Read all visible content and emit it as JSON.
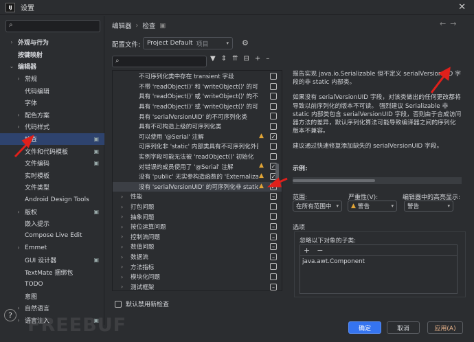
{
  "window": {
    "app_icon": "IJ",
    "title": "设置",
    "close": "✕"
  },
  "sidebar": {
    "items": [
      {
        "label": "外观与行为",
        "chev": "›",
        "bold": true
      },
      {
        "label": "按键映射",
        "chev": "",
        "bold": true
      },
      {
        "label": "编辑器",
        "chev": "⌄",
        "bold": true
      },
      {
        "label": "常规",
        "chev": "›",
        "indent": 1
      },
      {
        "label": "代码编辑",
        "chev": "",
        "indent": 1
      },
      {
        "label": "字体",
        "chev": "",
        "indent": 1
      },
      {
        "label": "配色方案",
        "chev": "›",
        "indent": 1
      },
      {
        "label": "代码样式",
        "chev": "›",
        "indent": 1
      },
      {
        "label": "检查",
        "chev": "",
        "indent": 1,
        "selected": true,
        "badge": "▣"
      },
      {
        "label": "文件和代码模板",
        "chev": "",
        "indent": 1,
        "badge": "▣"
      },
      {
        "label": "文件编码",
        "chev": "",
        "indent": 1,
        "badge": "▣"
      },
      {
        "label": "实时模板",
        "chev": "",
        "indent": 1
      },
      {
        "label": "文件类型",
        "chev": "",
        "indent": 1
      },
      {
        "label": "Android Design Tools",
        "chev": "",
        "indent": 1
      },
      {
        "label": "版权",
        "chev": "›",
        "indent": 1,
        "badge": "▣"
      },
      {
        "label": "嵌入提示",
        "chev": "",
        "indent": 1
      },
      {
        "label": "Compose Live Edit",
        "chev": "",
        "indent": 1
      },
      {
        "label": "Emmet",
        "chev": "›",
        "indent": 1
      },
      {
        "label": "GUI 设计器",
        "chev": "",
        "indent": 1,
        "badge": "▣"
      },
      {
        "label": "TextMate 捆绑包",
        "chev": "",
        "indent": 1
      },
      {
        "label": "TODO",
        "chev": "",
        "indent": 1
      },
      {
        "label": "意图",
        "chev": "",
        "indent": 1
      },
      {
        "label": "自然语言",
        "chev": "›",
        "indent": 1
      },
      {
        "label": "语言注入",
        "chev": "›",
        "indent": 1,
        "badge": "▣"
      }
    ]
  },
  "header": {
    "crumb1": "编辑器",
    "crumb_sep": "›",
    "crumb2": "检查",
    "crumb_badge": "▣",
    "back": "←",
    "forward": "→"
  },
  "profile": {
    "label": "配置文件:",
    "value": "Project Default",
    "hint": "项目",
    "dd": "▾"
  },
  "tree": {
    "search_icon": "⌕",
    "rows": [
      {
        "label": "不可序列化类中存在 transient 字段",
        "cb": "",
        "warn": false
      },
      {
        "label": "不带 'readObject()' 和 'writeObject()' 的可序",
        "cb": "",
        "warn": false
      },
      {
        "label": "具有 'readObject()' 或 'writeObject()' 的不可",
        "cb": "",
        "warn": false
      },
      {
        "label": "具有 'readObject()' 或 'writeObject()' 的可外",
        "cb": "",
        "warn": false
      },
      {
        "label": "具有 'serialVersionUID' 的不可序列化类",
        "cb": "",
        "warn": false
      },
      {
        "label": "具有不可构造上级的可序列化类",
        "cb": "",
        "warn": false
      },
      {
        "label": "可以使用 '@Serial' 注解",
        "cb": "✓",
        "warn": true
      },
      {
        "label": "可序列化非 'static' 内部类具有不可序列化外部",
        "cb": "",
        "warn": false
      },
      {
        "label": "实例字段可能无法被 'readObject()' 初始化",
        "cb": "",
        "warn": false
      },
      {
        "label": "对错误的成员使用了 '@Serial' 注解",
        "cb": "✓",
        "warn": true
      },
      {
        "label": "没有 'public' 无实参构造函数的 'Externalizab",
        "cb": "✓",
        "warn": true
      },
      {
        "label": "没有 'serialVersionUID' 的可序列化非 static",
        "cb": "✓",
        "warn": true,
        "selected": true
      },
      {
        "label": "性能",
        "cb": "minus",
        "group": true
      },
      {
        "label": "打包问题",
        "cb": "",
        "group": true
      },
      {
        "label": "抽象问题",
        "cb": "",
        "group": true
      },
      {
        "label": "按位运算问题",
        "cb": "minus",
        "group": true
      },
      {
        "label": "控制流问题",
        "cb": "minus",
        "group": true
      },
      {
        "label": "数值问题",
        "cb": "minus",
        "group": true
      },
      {
        "label": "数据流",
        "cb": "minus",
        "group": true
      },
      {
        "label": "方法指标",
        "cb": "",
        "group": true
      },
      {
        "label": "模块化问题",
        "cb": "",
        "group": true
      },
      {
        "label": "测试框架",
        "cb": "minus",
        "group": true
      }
    ]
  },
  "disable_new": "默认禁用新检查",
  "description": {
    "p1": "报告实现 java.io.Serializable 但不定义 serialVersionUID 字段的非 static 内部类。",
    "p2": "如果没有 serialVersionUID 字段，对该类做出的任何更改都将导致以前序列化的版本不可读。 强烈建议 Serializable 非 static 内部类包含 serialVersionUID 字段，否则由于合成访问器方法的差异，默认序列化算法可能导致编译器之间的序列化版本不兼容。",
    "p3": "建议通过快速修复添加缺失的 serialVersionUID 字段。",
    "example": "示例:"
  },
  "scope": {
    "label": "范围:",
    "value": "在所有范围中"
  },
  "severity": {
    "label": "严重性(V):",
    "value": "警告"
  },
  "highlight": {
    "label": "编辑器中的高亮显示:",
    "value": "警告"
  },
  "options": {
    "label": "选项",
    "ignore_label": "忽略以下对象的子类:",
    "add": "+",
    "remove": "−",
    "items": [
      "java.awt.Component"
    ]
  },
  "footer": {
    "help": "?",
    "ok": "确定",
    "cancel": "取消",
    "apply": "应用(A)"
  },
  "watermark": "FREEBUF",
  "accent": "#3574f0",
  "warning_color": "#e2a536",
  "selection_color": "#2e436e"
}
